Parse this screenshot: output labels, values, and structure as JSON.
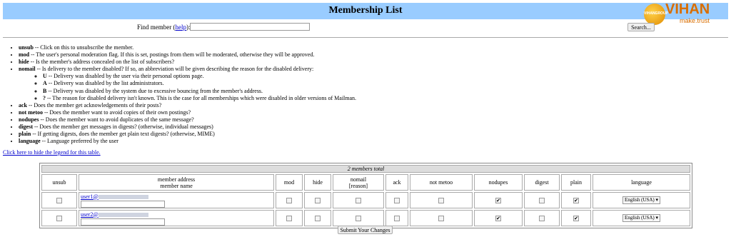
{
  "header": {
    "title": "Membership List"
  },
  "logo": {
    "badge": "VIHANGROUP",
    "brand": "VIHAN",
    "tagline": "make.trust"
  },
  "find": {
    "label": "Find member (",
    "help": "help",
    "label_end": "):",
    "value": "",
    "search_label": "Search..."
  },
  "legend": [
    {
      "term": "unsub",
      "desc": " -- Click on this to unsubscribe the member."
    },
    {
      "term": "mod",
      "desc": " -- The user's personal moderation flag. If this is set, postings from them will be moderated, otherwise they will be approved."
    },
    {
      "term": "hide",
      "desc": " -- Is the member's address concealed on the list of subscribers?"
    },
    {
      "term": "nomail",
      "desc": " -- Is delivery to the member disabled? If so, an abbreviation will be given describing the reason for the disabled delivery:"
    },
    {
      "term": "ack",
      "desc": " -- Does the member get acknowledgements of their posts?"
    },
    {
      "term": "not metoo",
      "desc": " -- Does the member want to avoid copies of their own postings?"
    },
    {
      "term": "nodupes",
      "desc": " -- Does the member want to avoid duplicates of the same message?"
    },
    {
      "term": "digest",
      "desc": " -- Does the member get messages in digests? (otherwise, individual messages)"
    },
    {
      "term": "plain",
      "desc": " -- If getting digests, does the member get plain text digests? (otherwise, MIME)"
    },
    {
      "term": "language",
      "desc": " -- Language preferred by the user"
    }
  ],
  "nomail_reasons": [
    {
      "term": "U",
      "desc": " -- Delivery was disabled by the user via their personal options page."
    },
    {
      "term": "A",
      "desc": " -- Delivery was disabled by the list administrators."
    },
    {
      "term": "B",
      "desc": " -- Delivery was disabled by the system due to excessive bouncing from the member's address."
    },
    {
      "term": "?",
      "desc": " -- The reason for disabled delivery isn't known. This is the case for all memberships which were disabled in older versions of Mailman."
    }
  ],
  "hide_legend_link": "Click here to hide the legend for this table.",
  "table": {
    "total": "2 members total",
    "headers": [
      "unsub",
      "member address",
      "member name",
      "mod",
      "hide",
      "nomail",
      "[reason]",
      "ack",
      "not metoo",
      "nodupes",
      "digest",
      "plain",
      "language"
    ],
    "rows": [
      {
        "user": "user1",
        "at": "@",
        "unsub": "",
        "mod": "",
        "hide": "",
        "nomail": "",
        "ack": "",
        "notmetoo": "",
        "nodupes": "✔",
        "digest": "",
        "plain": "✔",
        "language": "English (USA) ▾"
      },
      {
        "user": "user2",
        "at": "@",
        "unsub": "",
        "mod": "",
        "hide": "",
        "nomail": "",
        "ack": "",
        "notmetoo": "",
        "nodupes": "✔",
        "digest": "",
        "plain": "✔",
        "language": "English (USA) ▾"
      }
    ]
  },
  "submit_label": "Submit Your Changes"
}
